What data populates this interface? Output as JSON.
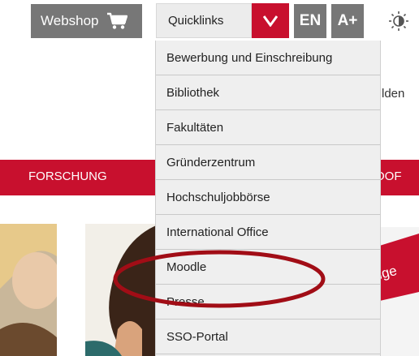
{
  "topbar": {
    "webshop_label": "Webshop",
    "quicklinks_label": "Quicklinks",
    "language_label": "EN",
    "fontsize_label": "A+"
  },
  "background": {
    "partial_text": "lden",
    "nav_label": "FORSCHUNG",
    "nav_right_partial": "OOF",
    "banner_partial": "nge"
  },
  "quicklinks_menu": {
    "items": [
      "Bewerbung und Einschreibung",
      "Bibliothek",
      "Fakultäten",
      "Gründerzentrum",
      "Hochschuljobbörse",
      "International Office",
      "Moodle",
      "Presse",
      "SSO-Portal"
    ]
  },
  "colors": {
    "accent": "#c8102e",
    "button_gray": "#777777",
    "menu_bg": "#efefef"
  },
  "icons": [
    "cart-icon",
    "chevron-down-icon",
    "contrast-icon"
  ]
}
